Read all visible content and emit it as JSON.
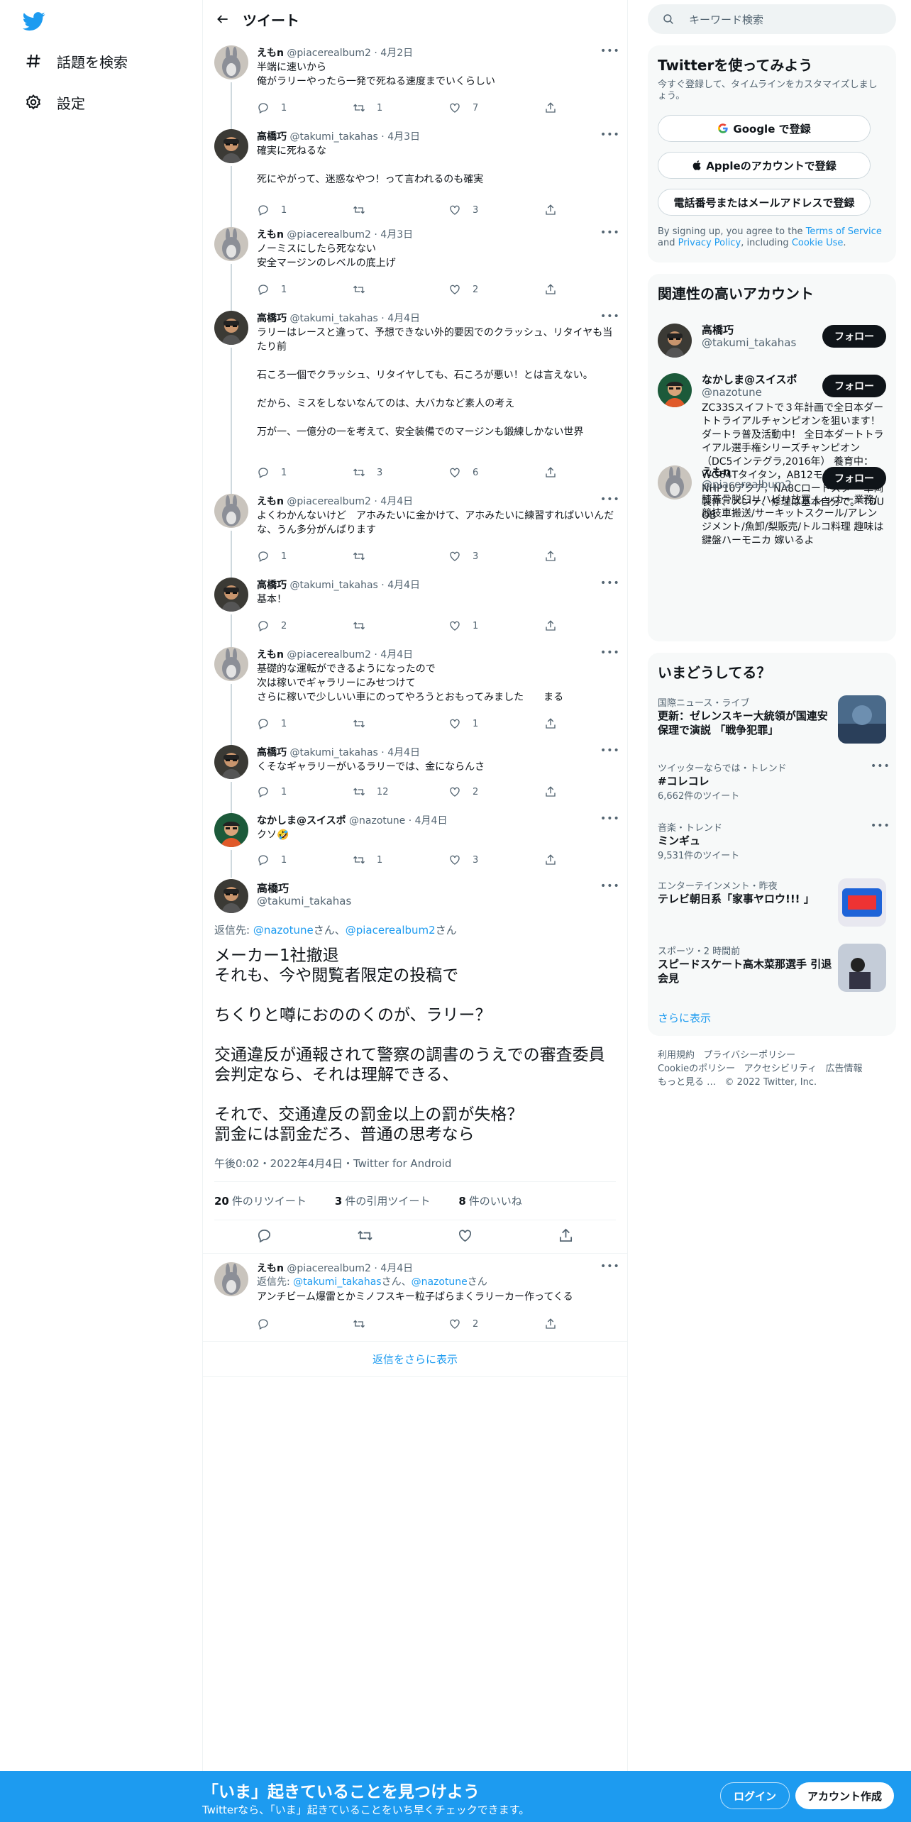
{
  "nav": {
    "explore_label": "話題を検索",
    "settings_label": "設定"
  },
  "header": {
    "title": "ツイート"
  },
  "tweets": [
    {
      "name": "えもn",
      "handle": "@piacerealbum2",
      "date": "4月2日",
      "text": "半端に速いから\n俺がラリーやったら一発で死ねる速度までいくらしい",
      "replies": "1",
      "retweets": "1",
      "likes": "7"
    },
    {
      "name": "高橋巧",
      "handle": "@takumi_takahas",
      "date": "4月3日",
      "text": "確実に死ねるな\n\n死にやがって、迷惑なやつ！って言われるのも確実",
      "replies": "1",
      "retweets": "",
      "likes": "3"
    },
    {
      "name": "えもn",
      "handle": "@piacerealbum2",
      "date": "4月3日",
      "text": "ノーミスにしたら死なない\n安全マージンのレベルの底上げ",
      "replies": "1",
      "retweets": "",
      "likes": "2"
    },
    {
      "name": "高橋巧",
      "handle": "@takumi_takahas",
      "date": "4月4日",
      "text": "ラリーはレースと違って、予想できない外的要因でのクラッシュ、リタイヤも当たり前\n\n石ころ一個でクラッシュ、リタイヤしても、石ころが悪い！とは言えない。\n\nだから、ミスをしないなんてのは、大バカなど素人の考え\n\n万が一、一億分の一を考えて、安全装備でのマージンも鍛練しかない世界",
      "replies": "1",
      "retweets": "3",
      "likes": "6"
    },
    {
      "name": "えもn",
      "handle": "@piacerealbum2",
      "date": "4月4日",
      "text": "よくわかんないけど　アホみたいに金かけて、アホみたいに練習すればいいんだな、うん多分がんばります",
      "replies": "1",
      "retweets": "",
      "likes": "3"
    },
    {
      "name": "高橋巧",
      "handle": "@takumi_takahas",
      "date": "4月4日",
      "text": "基本！",
      "replies": "2",
      "retweets": "",
      "likes": "1"
    },
    {
      "name": "えもn",
      "handle": "@piacerealbum2",
      "date": "4月4日",
      "text": "基礎的な運転ができるようになったので\n次は稼いでギャラリーにみせつけて\nさらに稼いで少しいい車にのってやろうとおもってみました　　まる",
      "replies": "1",
      "retweets": "",
      "likes": "1"
    },
    {
      "name": "高橋巧",
      "handle": "@takumi_takahas",
      "date": "4月4日",
      "text": "くそなギャラリーがいるラリーでは、金にならんさ",
      "replies": "1",
      "retweets": "12",
      "likes": "2"
    },
    {
      "name": "なかしま@スイスポ",
      "handle": "@nazotune",
      "date": "4月4日",
      "text": "クソ🤣",
      "replies": "1",
      "retweets": "1",
      "likes": "3"
    }
  ],
  "focus": {
    "name": "高橋巧",
    "handle": "@takumi_takahas",
    "reply_prefix": "返信先: ",
    "reply_user1": "@nazotune",
    "reply_san1": "さん、",
    "reply_user2": "@piacerealbum2",
    "reply_san2": "さん",
    "text": "メーカー1社撤退\nそれも、今や閲覧者限定の投稿で\n\nちくりと噂におののくのが、ラリー？\n\n交通違反が通報されて警察の調書のうえでの審査委員会判定なら、それは理解できる、\n\nそれで、交通違反の罰金以上の罰が失格？\n罰金には罰金だろ、普通の思考なら",
    "meta": "午後0:02・2022年4月4日・Twitter for Android",
    "retweet_count": "20",
    "retweet_label": "件のリツイート",
    "quote_count": "3",
    "quote_label": "件の引用ツイート",
    "like_count": "8",
    "like_label": "件のいいね"
  },
  "reply": {
    "name": "えもn",
    "handle": "@piacerealbum2",
    "date": "4月4日",
    "reply_prefix": "返信先: ",
    "reply_user1": "@takumi_takahas",
    "reply_san1": "さん、",
    "reply_user2": "@nazotune",
    "reply_san2": "さん",
    "text": "アンチビーム爆雷とかミノフスキー粒子ばらまくラリーカー作ってくる",
    "replies": "",
    "retweets": "",
    "likes": "2"
  },
  "show_more": "返信をさらに表示",
  "search": {
    "placeholder": "キーワード検索"
  },
  "signup": {
    "title": "Twitterを使ってみよう",
    "sub": "今すぐ登録して、タイムラインをカスタマイズしましょう。",
    "google": "Google で登録",
    "apple": "Appleのアカウントで登録",
    "phone": "電話番号またはメールアドレスで登録",
    "terms_pre": "By signing up, you agree to the ",
    "terms_link": "Terms of Service",
    "terms_and": " and ",
    "privacy_link": "Privacy Policy",
    "terms_incl": ", including ",
    "cookie_link": "Cookie Use",
    "terms_end": "."
  },
  "related": {
    "title": "関連性の高いアカウント",
    "follow": "フォロー",
    "accounts": [
      {
        "name": "高橋巧",
        "handle": "@takumi_takahas",
        "bio": ""
      },
      {
        "name": "なかしま@スイスポ",
        "handle": "@nazotune",
        "bio": "ZC33Sスイフトで３年計画で全日本ダートトライアルチャンピオンを狙います！ダートラ普及活動中！ 全日本ダートトライアル選手権シリーズチャンピオン（DC5インテグラ,2016年） 養育中：WG64Tタイタン，AB12モトコンポ，NHP10アクア，NA8Cロードスター 車両製作、メンテ、修理は基本自分で。 TDU OB"
      },
      {
        "name": "えもn",
        "handle": "@piacerealbum2",
        "bio": "膝蓋骨脱臼リハビリ放置 レッカー業務/競技車搬送/サーキットスクール/アレンジメント/魚卸/梨販売/トルコ料理 趣味は鍵盤ハーモニカ 嫁いるよ"
      }
    ]
  },
  "trends": {
    "title": "いまどうしてる？",
    "items": [
      {
        "cat": "国際ニュース・ライブ",
        "title": "更新：ゼレンスキー大統領が国連安保理で演説 「戦争犯罪」",
        "count": ""
      },
      {
        "cat": "ツイッターならでは・トレンド",
        "title": "#コレコレ",
        "count": "6,662件のツイート"
      },
      {
        "cat": "音楽・トレンド",
        "title": "ミンギュ",
        "count": "9,531件のツイート"
      },
      {
        "cat": "エンターテインメント・昨夜",
        "title": "テレビ朝日系「家事ヤロウ!!! 」",
        "count": ""
      },
      {
        "cat": "スポーツ・2 時間前",
        "title": "スピードスケート高木菜那選手 引退会見",
        "count": ""
      }
    ],
    "more": "さらに表示"
  },
  "footer": {
    "terms": "利用規約",
    "privacy": "プライバシーポリシー",
    "cookie": "Cookieのポリシー",
    "access": "アクセシビリティ",
    "ads": "広告情報",
    "more": "もっと見る …",
    "copy": "© 2022 Twitter, Inc."
  },
  "bottom": {
    "title": "「いま」起きていることを見つけよう",
    "sub": "Twitterなら、「いま」起きていることをいち早くチェックできます。",
    "login": "ログイン",
    "signup": "アカウント作成"
  },
  "colors": {
    "accent": "#1d9bf0",
    "text": "#0f1419",
    "muted": "#536471"
  }
}
